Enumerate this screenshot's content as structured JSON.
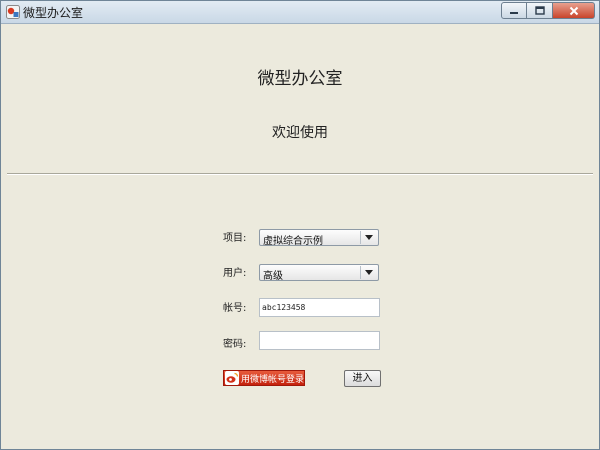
{
  "window": {
    "title": "微型办公室"
  },
  "header": {
    "app_title": "微型办公室",
    "welcome_text": "欢迎使用"
  },
  "form": {
    "project_label": "项目:",
    "project_value": "虚拟综合示例",
    "user_label": "用户:",
    "user_value": "高级",
    "account_label": "帐号:",
    "account_value": "abc123458",
    "password_label": "密码:",
    "password_value": ""
  },
  "actions": {
    "weibo_login_label": "用微博帐号登录",
    "enter_label": "进入"
  },
  "colors": {
    "window_bg": "#eceadd",
    "weibo_red": "#d2321a"
  },
  "icons": {
    "app": "app-logo-icon",
    "dropdown": "chevron-down-icon",
    "weibo": "weibo-icon"
  }
}
